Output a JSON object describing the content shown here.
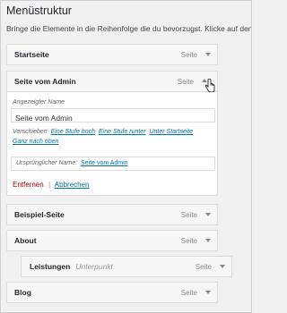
{
  "heading": "Menüstruktur",
  "description": "Bringe die Elemente in die Reihenfolge die du bevorzugst. Klicke auf den Pfeil auf der",
  "menu_items": [
    {
      "label": "Startseite",
      "type": "Seite"
    },
    {
      "label": "Seite vom Admin",
      "type": "Seite"
    },
    {
      "label": "Beispiel-Seite",
      "type": "Seite"
    },
    {
      "label": "About",
      "type": "Seite"
    },
    {
      "label": "Leistungen",
      "sublabel": "Unterpunkt",
      "type": "Seite"
    },
    {
      "label": "Blog",
      "type": "Seite"
    }
  ],
  "settings": {
    "nav_label_title": "Angezeigter Name",
    "nav_label_value": "Seite vom Admin",
    "move_label": "Verschieben",
    "move_links": [
      "Eine Stufe hoch",
      "Eine Stufe runter",
      "Unter Startseite",
      "Ganz nach oben"
    ],
    "original_label": "Ursprünglicher Name:",
    "original_link": "Seite vom Admin",
    "remove": "Entfernen",
    "separator": "|",
    "cancel": "Abbrechen"
  }
}
